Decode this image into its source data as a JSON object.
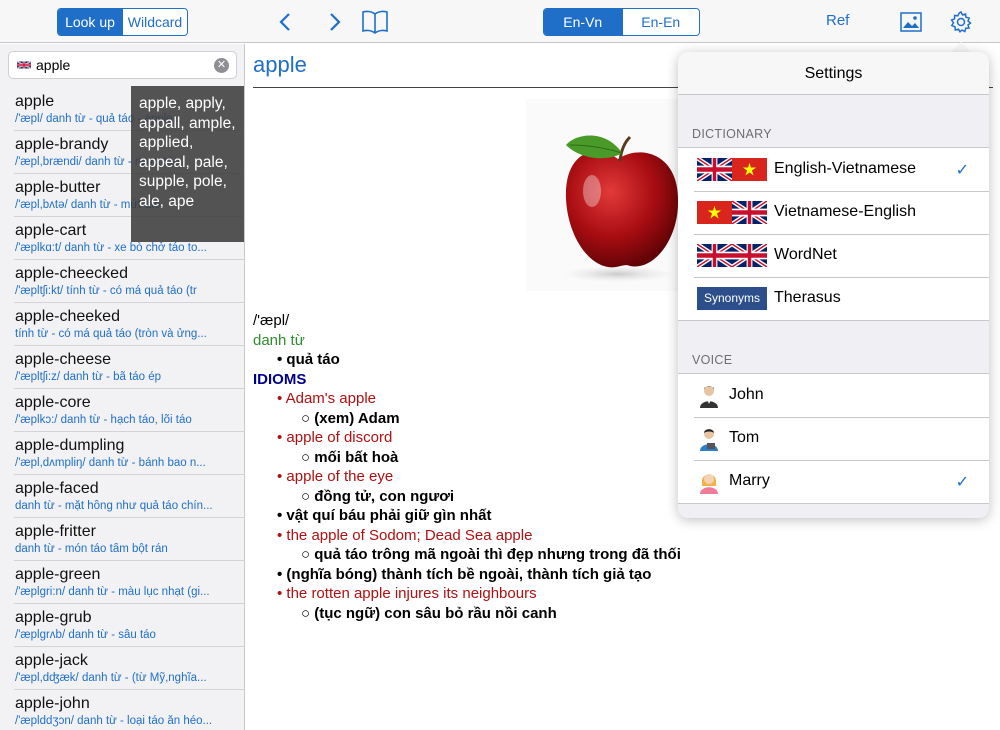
{
  "toolbar": {
    "lookup_label": "Look up",
    "wildcard_label": "Wildcard",
    "lang_envn_label": "En-Vn",
    "lang_enen_label": "En-En",
    "ref_label": "Ref",
    "back_icon": "chevron-left-icon",
    "forward_icon": "chevron-right-icon",
    "book_icon": "book-icon",
    "image_icon": "image-icon",
    "gear_icon": "gear-icon"
  },
  "search": {
    "value": "apple"
  },
  "suggestions": "apple, apply, appall, ample, applied, appeal, pale, supple, pole, ale, ape",
  "word_list": [
    {
      "word": "apple",
      "def": "/'æpl/ danh từ - quả táo - apple..."
    },
    {
      "word": "apple-brandy",
      "def": "/'æpl,brændi/ danh từ - rượu táo"
    },
    {
      "word": "apple-butter",
      "def": "/'æpl,bʌtə/ danh từ - mứt táo"
    },
    {
      "word": "apple-cart",
      "def": "/'æplkɑ:t/ danh từ - xe bò chở táo to..."
    },
    {
      "word": "apple-cheecked",
      "def": "/'æpltʃi:kt/ tính từ - có má quả táo (tr"
    },
    {
      "word": "apple-cheeked",
      "def": "tính từ - có má quả táo (tròn và ửng..."
    },
    {
      "word": "apple-cheese",
      "def": "/'æpltʃi:z/ danh từ - bã táo ép"
    },
    {
      "word": "apple-core",
      "def": "/'æplkɔ:/ danh từ - hạch táo, lõi táo"
    },
    {
      "word": "apple-dumpling",
      "def": "/'æpl,dʌmpliŋ/ danh từ - bánh bao n..."
    },
    {
      "word": "apple-faced",
      "def": "danh từ - mặt hồng như quả táo chín..."
    },
    {
      "word": "apple-fritter",
      "def": "danh từ - món táo tẩm bột rán"
    },
    {
      "word": "apple-green",
      "def": "/'æplgri:n/ danh từ - màu lục nhạt (gi..."
    },
    {
      "word": "apple-grub",
      "def": "/'æplgrʌb/ danh từ - sâu táo"
    },
    {
      "word": "apple-jack",
      "def": "/'æpl,dʤæk/ danh từ - (từ Mỹ,nghĩa..."
    },
    {
      "word": "apple-john",
      "def": "/'æplddʒɔn/ danh từ - loại táo ăn héo..."
    }
  ],
  "entry": {
    "headword": "apple",
    "pron": "/'æpl/",
    "pos": "danh từ",
    "lines": [
      {
        "level": "l1",
        "text": "• quả táo"
      },
      {
        "level": "idioms",
        "text": "IDIOMS"
      },
      {
        "level": "l1r",
        "text": "• Adam's apple"
      },
      {
        "level": "l2",
        "text": "○ (xem) Adam"
      },
      {
        "level": "l1r",
        "text": "• apple of discord"
      },
      {
        "level": "l2",
        "text": "○ mối bất hoà"
      },
      {
        "level": "l1r",
        "text": "• apple of the eye"
      },
      {
        "level": "l2",
        "text": "○ đồng tử, con ngươi"
      },
      {
        "level": "l1",
        "text": "• vật quí báu phải giữ gìn nhất"
      },
      {
        "level": "l1r",
        "text": "• the apple of Sodom; Dead Sea apple"
      },
      {
        "level": "l2",
        "text": "○ quả táo trông mã ngoài thì đẹp nhưng trong đã thối"
      },
      {
        "level": "l1",
        "text": "• (nghĩa bóng) thành tích bề ngoài, thành tích giả tạo"
      },
      {
        "level": "l1r",
        "text": "• the rotten apple injures its neighbours"
      },
      {
        "level": "l2",
        "text": "○ (tục ngữ) con sâu bỏ rầu nồi canh"
      }
    ]
  },
  "settings": {
    "title": "Settings",
    "dictionary_header": "DICTIONARY",
    "dictionaries": [
      {
        "label": "English-Vietnamese",
        "checked": true
      },
      {
        "label": "Vietnamese-English",
        "checked": false
      },
      {
        "label": "WordNet",
        "checked": false
      },
      {
        "label": "Therasus",
        "checked": false,
        "badge": "Synonyms"
      }
    ],
    "voice_header": "VOICE",
    "voices": [
      {
        "label": "John",
        "checked": false
      },
      {
        "label": "Tom",
        "checked": false
      },
      {
        "label": "Marry",
        "checked": true
      }
    ],
    "check_glyph": "✓"
  },
  "colors": {
    "accent": "#1f6fc9",
    "idiom_red": "#b01010",
    "pos_green": "#2e8b2e",
    "idioms_blue": "#00008b"
  }
}
